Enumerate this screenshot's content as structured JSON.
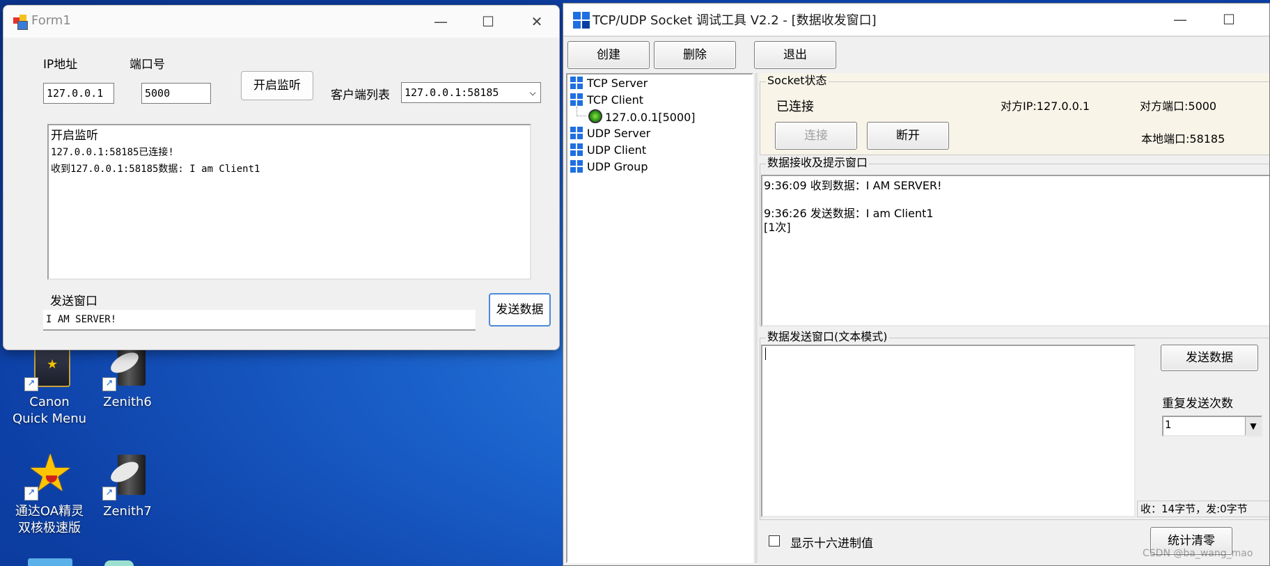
{
  "desktop": {
    "icons": [
      {
        "label": "Canon\nQuick Menu"
      },
      {
        "label": "Zenith6"
      },
      {
        "label": "通达OA精灵\n双核极速版"
      },
      {
        "label": "Zenith7"
      }
    ]
  },
  "form1": {
    "title": "Form1",
    "ip_label": "IP地址",
    "ip_value": "127.0.0.1",
    "port_label": "端口号",
    "port_value": "5000",
    "listen_button": "开启监听",
    "client_list_label": "客户端列表",
    "client_selected": "127.0.0.1:58185",
    "log": [
      "开启监听",
      "127.0.0.1:58185已连接!",
      "收到127.0.0.1:58185数据: I am Client1"
    ],
    "send_label": "发送窗口",
    "send_value": "I AM SERVER!",
    "send_button": "发送数据"
  },
  "socket_tool": {
    "title": "TCP/UDP Socket 调试工具 V2.2 - [数据收发窗口]",
    "toolbar": {
      "create": "创建",
      "delete": "删除",
      "exit": "退出"
    },
    "tree": {
      "tcp_server": "TCP Server",
      "tcp_client": "TCP Client",
      "tcp_client_child": "127.0.0.1[5000]",
      "udp_server": "UDP Server",
      "udp_client": "UDP Client",
      "udp_group": "UDP Group"
    },
    "status": {
      "group_title": "Socket状态",
      "state": "已连接",
      "peer_ip": "对方IP:127.0.0.1",
      "peer_port": "对方端口:5000",
      "local_port": "本地端口:58185",
      "connect_button": "连接",
      "disconnect_button": "断开"
    },
    "receive": {
      "group_title": "数据接收及提示窗口",
      "lines": [
        "9:36:09 收到数据：I AM SERVER!",
        "",
        "9:36:26 发送数据：I am Client1",
        "[1次]"
      ]
    },
    "send": {
      "group_title": "数据发送窗口(文本模式)",
      "send_button": "发送数据",
      "repeat_label": "重复发送次数",
      "repeat_value": "1",
      "stats": "收：14字节，发:0字节",
      "hex_checkbox_label": "显示十六进制值",
      "clear_stats_button": "统计清零"
    },
    "watermark": "CSDN @ba_wang_mao"
  }
}
